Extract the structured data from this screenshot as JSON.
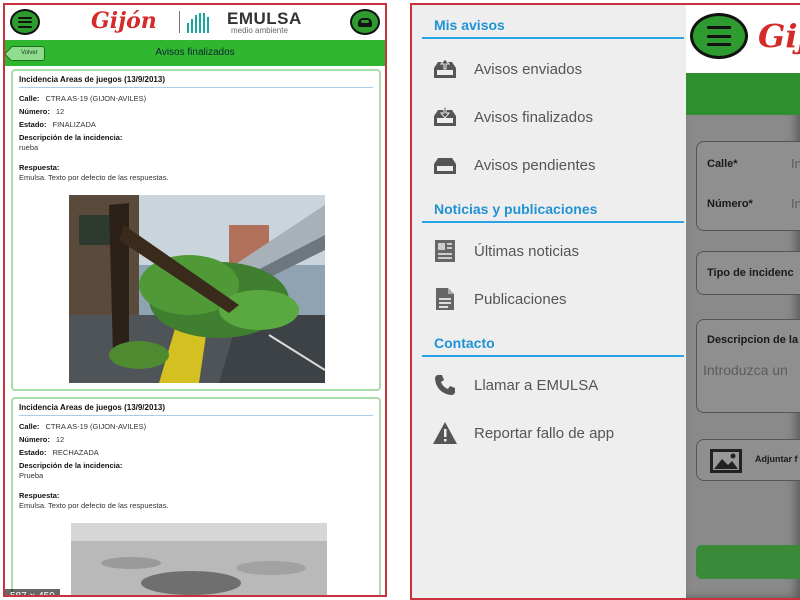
{
  "left_screen": {
    "header": {
      "logo_gijon": "Gijón",
      "logo_emulsa": "EMULSA",
      "logo_emulsa_sub": "medio ambiente"
    },
    "titlebar": {
      "back_label": "Volver",
      "title": "Avisos finalizados"
    },
    "labels": {
      "calle": "Calle:",
      "numero": "Número:",
      "estado": "Estado:",
      "descripcion": "Descripción de la incidencia:",
      "respuesta": "Respuesta:"
    },
    "cards": [
      {
        "title": "Incidencia Areas de juegos (13/9/2013)",
        "calle": "CTRA AS-19 (GIJON-AVILES)",
        "numero": "12",
        "estado": "FINALIZADA",
        "descripcion": "rueba",
        "respuesta": "Emulsa. Texto por defecto de las respuestas."
      },
      {
        "title": "Incidencia Areas de juegos (13/9/2013)",
        "calle": "CTRA AS-19 (GIJON-AVILES)",
        "numero": "12",
        "estado": "RECHAZADA",
        "descripcion": "Prueba",
        "respuesta": "Emulsa. Texto por defecto de las respuestas."
      }
    ]
  },
  "drawer": {
    "sections": [
      {
        "title": "Mis avisos"
      },
      {
        "title": "Noticias y publicaciones"
      },
      {
        "title": "Contacto"
      }
    ],
    "items": [
      {
        "label": "Avisos enviados",
        "icon": "inbox-upload-icon"
      },
      {
        "label": "Avisos finalizados",
        "icon": "inbox-download-icon"
      },
      {
        "label": "Avisos pendientes",
        "icon": "inbox-icon"
      },
      {
        "label": "Últimas noticias",
        "icon": "newspaper-icon"
      },
      {
        "label": "Publicaciones",
        "icon": "document-icon"
      },
      {
        "label": "Llamar a EMULSA",
        "icon": "phone-icon"
      },
      {
        "label": "Reportar fallo de app",
        "icon": "warning-icon"
      }
    ]
  },
  "background_form": {
    "logo_partial": "Gij",
    "calle_label": "Calle*",
    "calle_placeholder": "In",
    "numero_label": "Número*",
    "numero_placeholder": "In",
    "tipo_label": "Tipo de incidenc",
    "descripcion_label": "Descripcion de la",
    "descripcion_placeholder": "Introduzca un",
    "adjuntar_label": "Adjuntar f"
  },
  "image_size_badge": "587 × 459",
  "colors": {
    "brand_green": "#2fb82f",
    "accent_blue": "#1f93d4",
    "frame_red": "#c8323c",
    "gijon_red": "#d42a2a",
    "emulsa_teal": "#18a6a0"
  }
}
